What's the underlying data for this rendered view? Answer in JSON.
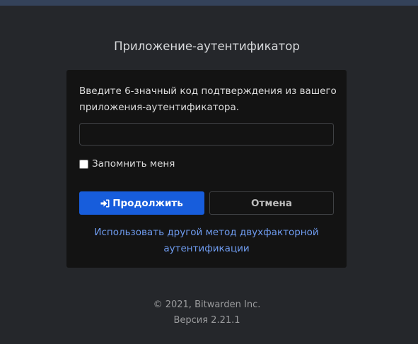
{
  "page": {
    "title": "Приложение-аутентификатор"
  },
  "form": {
    "instructions": "Введите 6-значный код подтверждения из вашего приложения-аутентификатора.",
    "code_value": "",
    "remember_label": "Запомнить меня",
    "remember_checked": false,
    "continue_label": "Продолжить",
    "continue_icon": "sign-in-icon",
    "cancel_label": "Отмена",
    "alt_method_link": "Использовать другой метод двухфакторной аутентификации"
  },
  "footer": {
    "copyright": "© 2021, Bitwarden Inc.",
    "version": "Версия 2.21.1"
  },
  "colors": {
    "background": "#25272b",
    "card": "#131313",
    "primary": "#175ddc",
    "link": "#6f9cf0",
    "top_strip": "#34425a"
  }
}
